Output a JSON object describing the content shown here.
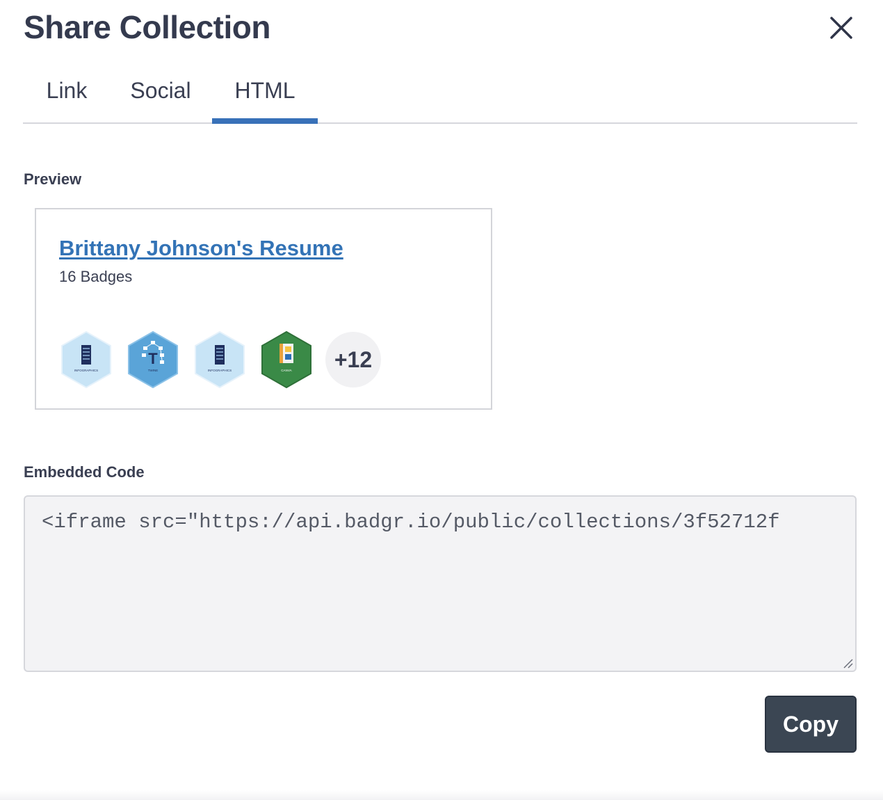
{
  "dialog": {
    "title": "Share Collection",
    "close_icon": "close-icon"
  },
  "tabs": [
    {
      "label": "Link",
      "active": false
    },
    {
      "label": "Social",
      "active": false
    },
    {
      "label": "HTML",
      "active": true
    }
  ],
  "preview": {
    "label": "Preview",
    "collection_title": "Brittany Johnson's Resume",
    "badge_count": "16 Badges",
    "badges": [
      {
        "name": "Infographics",
        "icon": "infographics-badge-icon",
        "caption": "INFOGRAPHICS",
        "color": "#c7e4f6"
      },
      {
        "name": "Twine",
        "icon": "twine-badge-icon",
        "caption": "TWINE",
        "color": "#5aa4d8"
      },
      {
        "name": "Infographics",
        "icon": "infographics-badge-icon",
        "caption": "INFOGRAPHICS",
        "color": "#c7e4f6"
      },
      {
        "name": "Canva",
        "icon": "canva-badge-icon",
        "caption": "CANVA",
        "color": "#3a8a47"
      }
    ],
    "more_badges": "+12"
  },
  "embed": {
    "label": "Embedded Code",
    "code": "<iframe src=\"https://api.badgr.io/public/collections/3f52712f"
  },
  "actions": {
    "copy_label": "Copy"
  },
  "colors": {
    "accent": "#3871b8",
    "link": "#3373b6",
    "button_bg": "#3b4653"
  }
}
